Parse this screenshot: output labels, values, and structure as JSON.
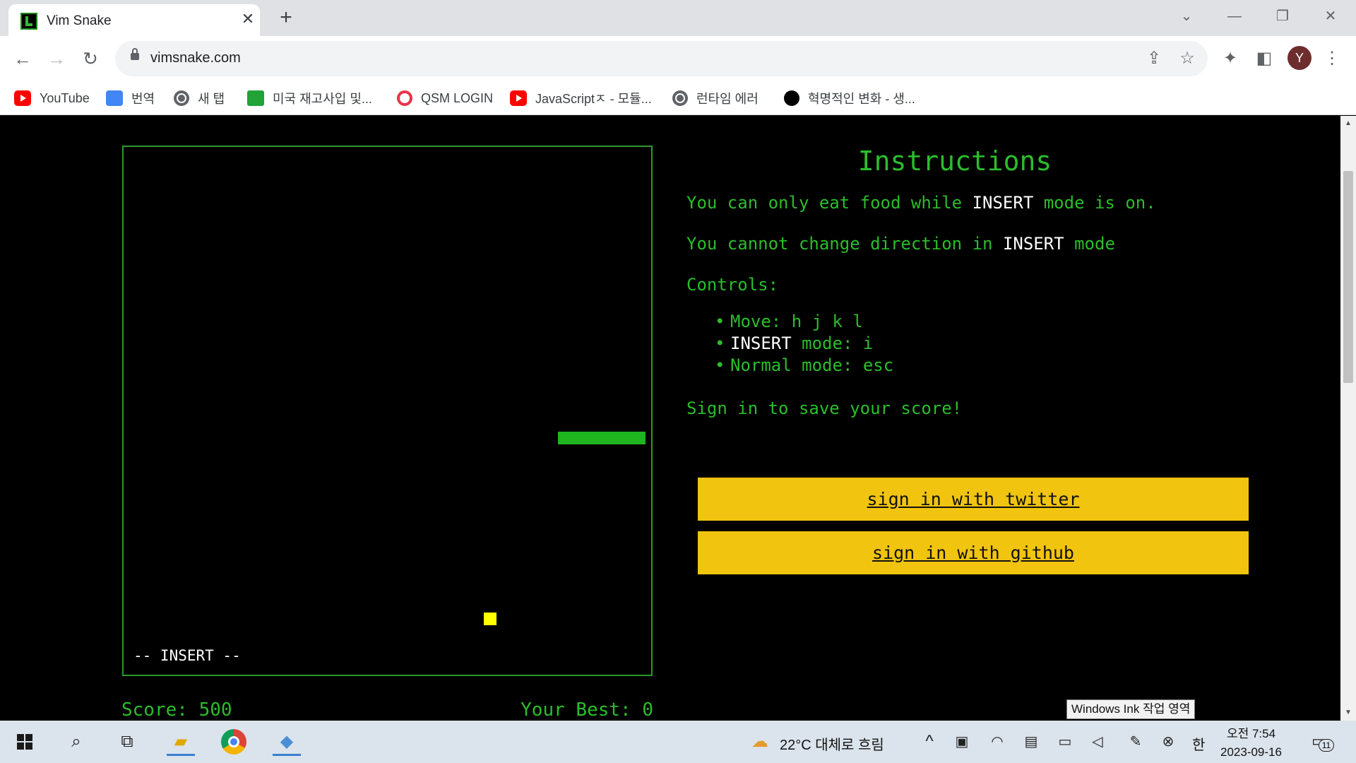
{
  "browser": {
    "tab_title": "Vim Snake",
    "url": "vimsnake.com",
    "profile_initial": "Y",
    "bookmarks": [
      {
        "label": "YouTube",
        "icon": "youtube-icon"
      },
      {
        "label": "번역",
        "icon": "translate-icon"
      },
      {
        "label": "새 탭",
        "icon": "globe-icon"
      },
      {
        "label": "미국 재고사입 및...",
        "icon": "cup-icon"
      },
      {
        "label": "QSM LOGIN",
        "icon": "qsm-icon"
      },
      {
        "label": "JavaScriptㅈ - 모듈...",
        "icon": "youtube-icon"
      },
      {
        "label": "런타임 에러",
        "icon": "globe-icon"
      },
      {
        "label": "혁명적인 변화 - 생...",
        "icon": "black-dot-icon"
      }
    ]
  },
  "game": {
    "mode_line": "-- INSERT --",
    "score_label": "Score: 500",
    "best_label": "Your Best: 0",
    "score": 500,
    "best": 0,
    "colors": {
      "snake": "#1fb51f",
      "food": "#ffff00",
      "border": "#2a9a2a",
      "text": "#2bbd2b"
    }
  },
  "instructions": {
    "title": "Instructions",
    "line1_pre": "You can only eat food while ",
    "line1_kw": "INSERT",
    "line1_post": " mode is on.",
    "line2_pre": "You cannot change direction in ",
    "line2_kw": "INSERT",
    "line2_post": " mode",
    "controls_heading": "Controls:",
    "control_move": "Move: h j k l",
    "control_insert_kw": "INSERT",
    "control_insert_post": " mode: i",
    "control_normal": "Normal mode: esc",
    "signin_prompt": "Sign in to save your score!",
    "twitter_button": "sign in with twitter",
    "github_button": "sign in with github",
    "button_color": "#f1c40f"
  },
  "taskbar": {
    "weather": "22°C 대체로 흐림",
    "ime": "한",
    "time": "오전 7:54",
    "date": "2023-09-16",
    "notification_count": "11",
    "ink_tooltip": "Windows Ink 작업 영역"
  }
}
